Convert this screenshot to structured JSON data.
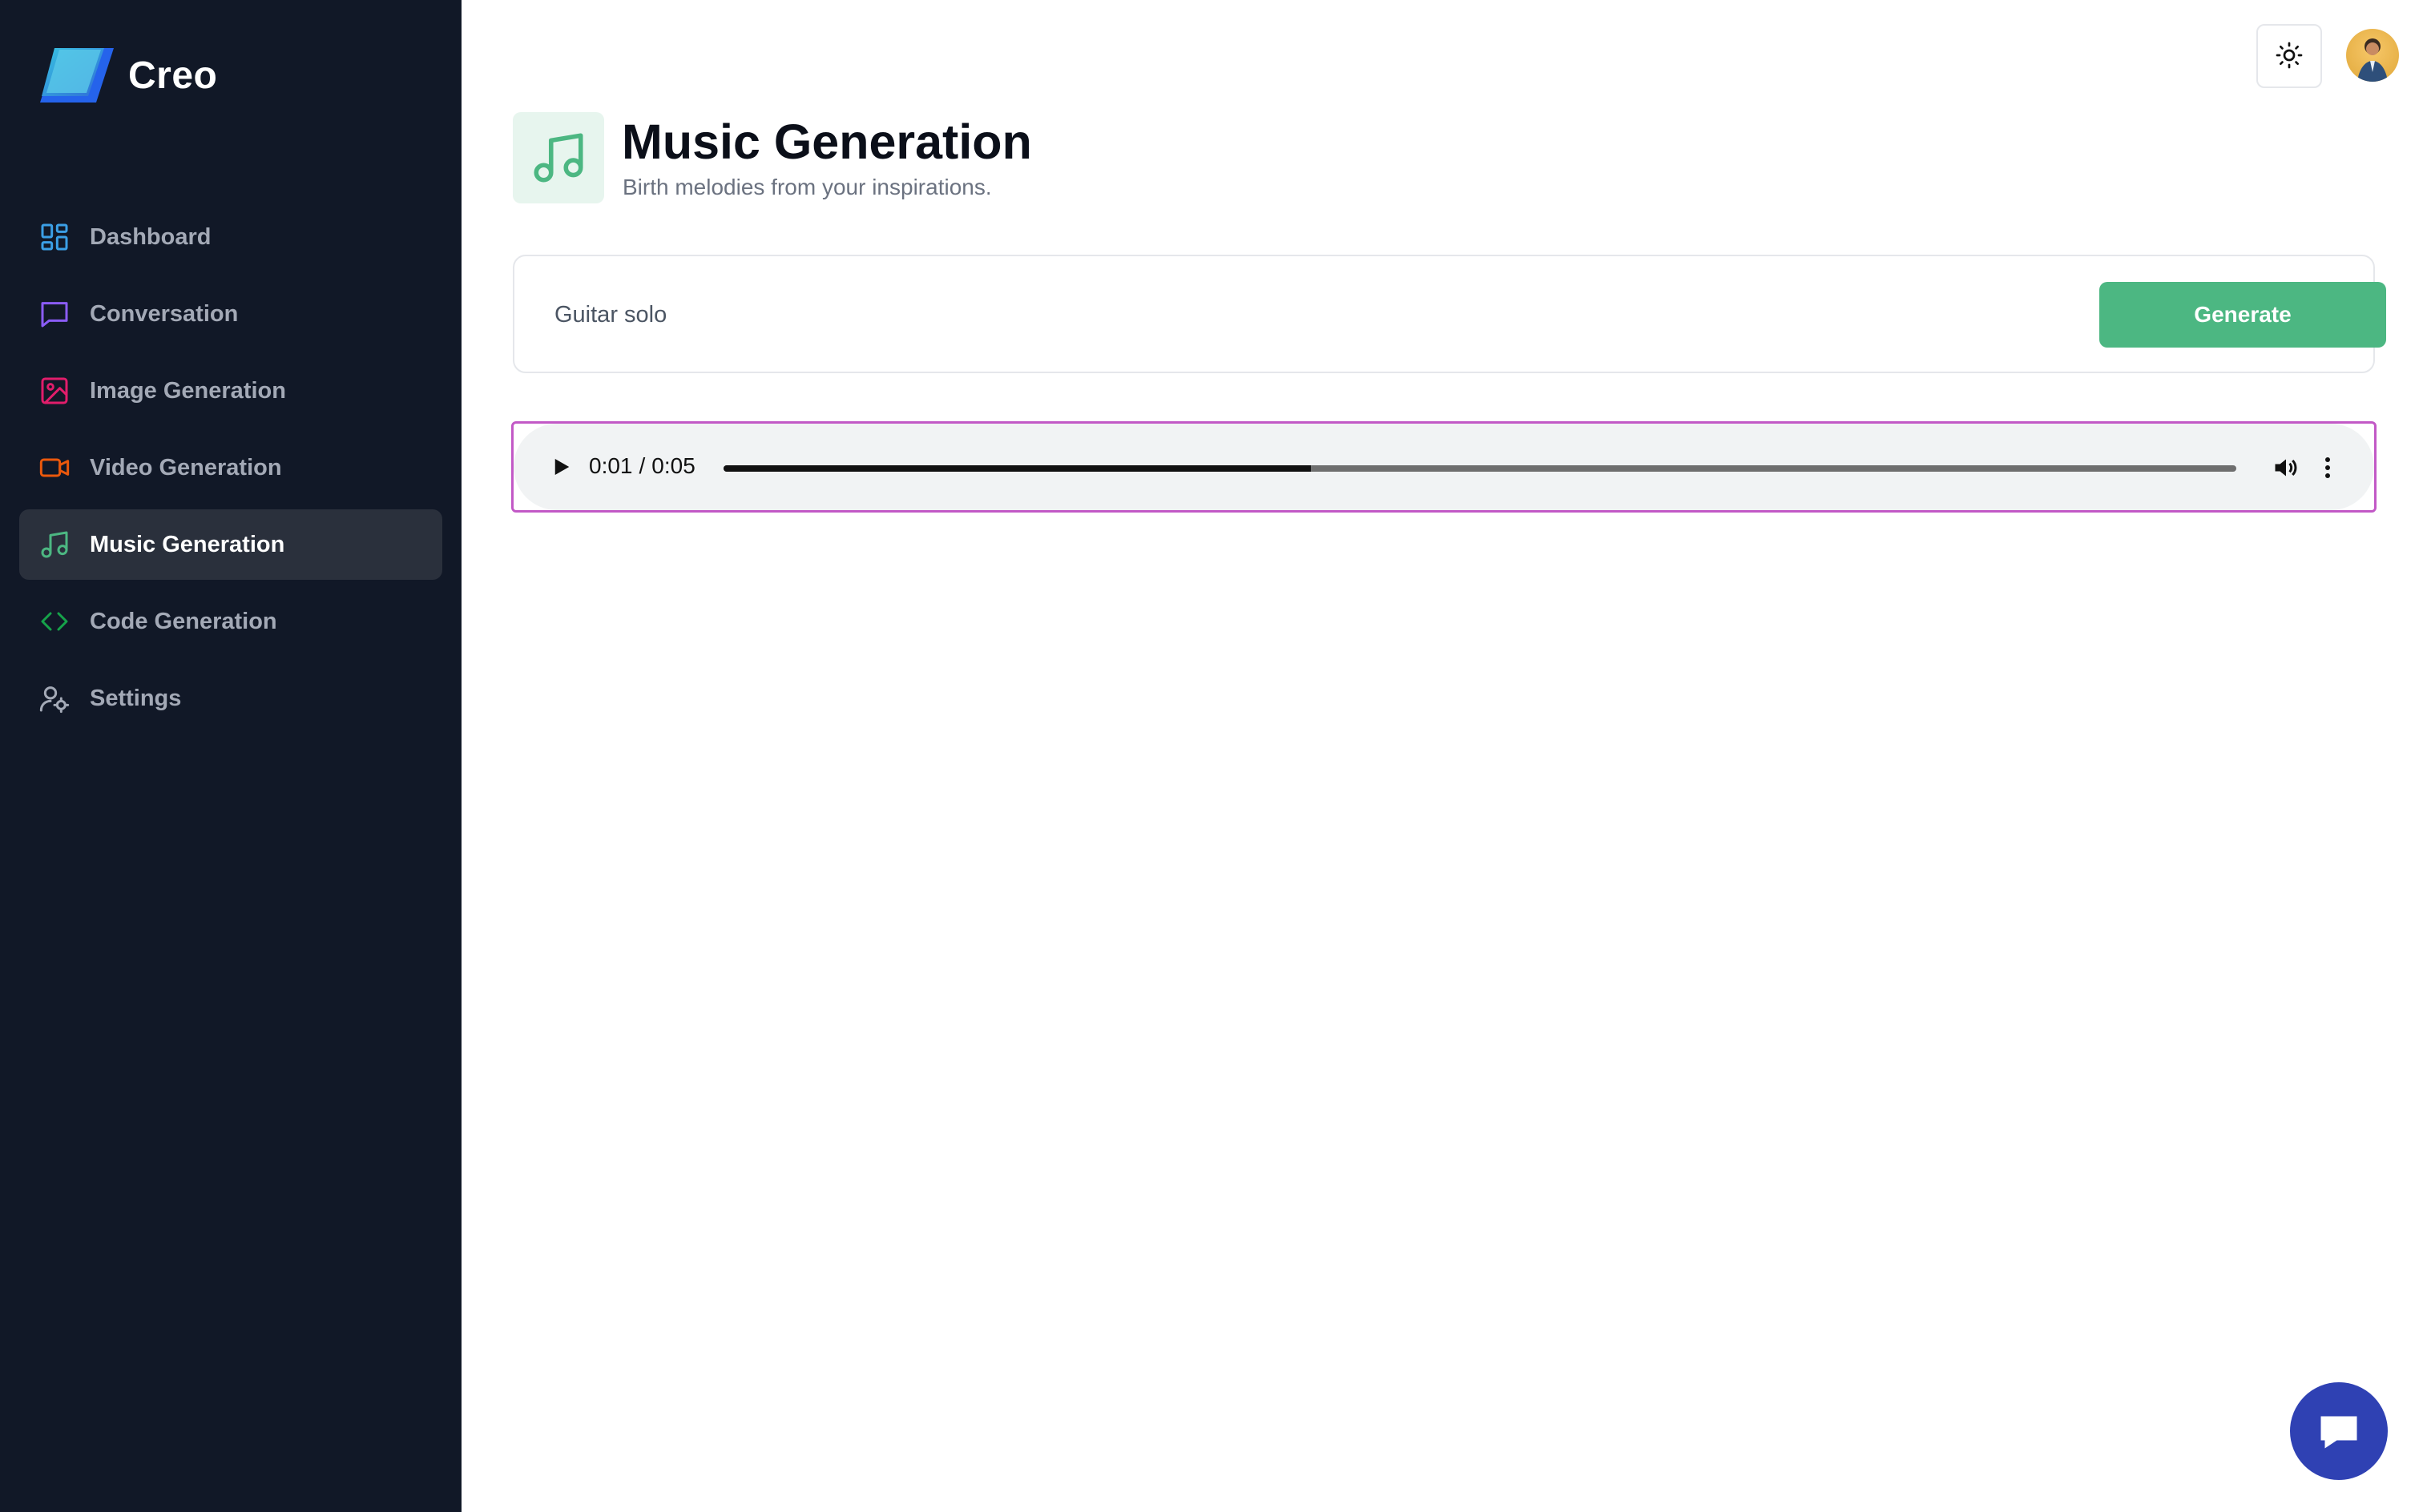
{
  "brand": {
    "name": "Creo"
  },
  "sidebar": {
    "items": [
      {
        "label": "Dashboard",
        "icon": "dashboard-icon",
        "color": "#3b9fe6",
        "active": false
      },
      {
        "label": "Conversation",
        "icon": "chat-bubble-icon",
        "color": "#8b5cf6",
        "active": false
      },
      {
        "label": "Image Generation",
        "icon": "image-icon",
        "color": "#e11d6b",
        "active": false
      },
      {
        "label": "Video Generation",
        "icon": "video-icon",
        "color": "#ea580c",
        "active": false
      },
      {
        "label": "Music Generation",
        "icon": "music-icon",
        "color": "#4cb782",
        "active": true
      },
      {
        "label": "Code Generation",
        "icon": "code-icon",
        "color": "#16a34a",
        "active": false
      },
      {
        "label": "Settings",
        "icon": "user-settings-icon",
        "color": "#a3a9b6",
        "active": false
      }
    ]
  },
  "header": {
    "title": "Music Generation",
    "subtitle": "Birth melodies from your inspirations.",
    "icon": "music-icon"
  },
  "prompt": {
    "value": "Guitar solo",
    "generate_label": "Generate"
  },
  "audio": {
    "current_time": "0:01",
    "duration": "0:05",
    "progress_percent": 38.8
  },
  "colors": {
    "sidebar_bg": "#111827",
    "accent": "#4cb782",
    "audio_border": "#c259c6",
    "fab": "#2f41b3"
  }
}
